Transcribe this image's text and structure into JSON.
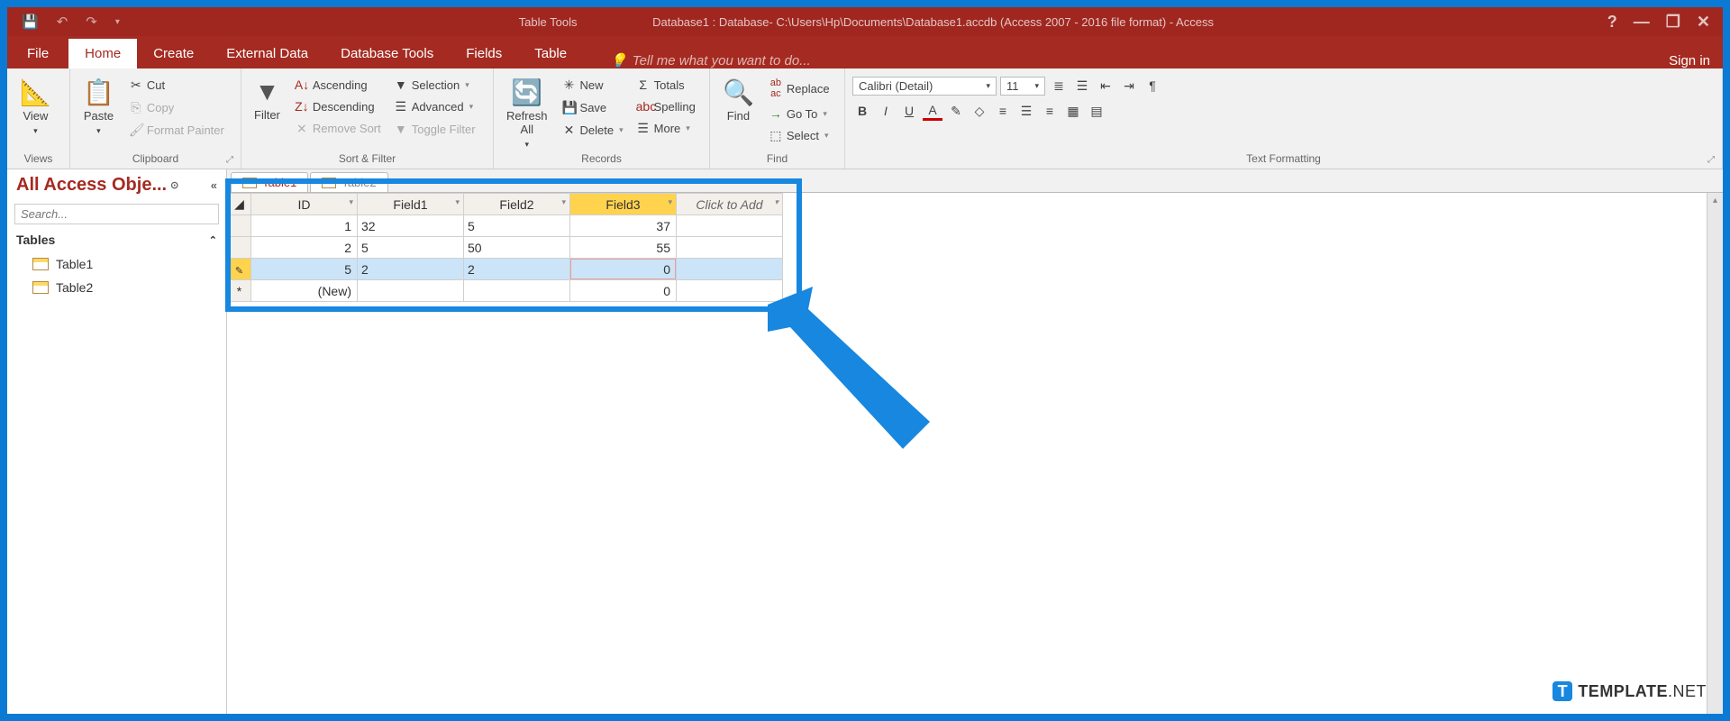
{
  "titlebar": {
    "table_tools": "Table Tools",
    "title": "Database1 : Database- C:\\Users\\Hp\\Documents\\Database1.accdb (Access 2007 - 2016 file format) - Access"
  },
  "menu": {
    "file": "File",
    "home": "Home",
    "create": "Create",
    "external_data": "External Data",
    "database_tools": "Database Tools",
    "fields": "Fields",
    "table": "Table",
    "tellme": "Tell me what you want to do...",
    "signin": "Sign in"
  },
  "ribbon": {
    "views": {
      "label": "Views",
      "view": "View"
    },
    "clipboard": {
      "label": "Clipboard",
      "paste": "Paste",
      "cut": "Cut",
      "copy": "Copy",
      "format_painter": "Format Painter"
    },
    "sort_filter": {
      "label": "Sort & Filter",
      "filter": "Filter",
      "ascending": "Ascending",
      "descending": "Descending",
      "remove_sort": "Remove Sort",
      "selection": "Selection",
      "advanced": "Advanced",
      "toggle_filter": "Toggle Filter"
    },
    "records": {
      "label": "Records",
      "refresh_all": "Refresh\nAll",
      "new": "New",
      "save": "Save",
      "delete": "Delete",
      "totals": "Totals",
      "spelling": "Spelling",
      "more": "More"
    },
    "find": {
      "label": "Find",
      "find": "Find",
      "replace": "Replace",
      "goto": "Go To",
      "select": "Select"
    },
    "text_formatting": {
      "label": "Text Formatting",
      "font_name": "Calibri (Detail)",
      "font_size": "11"
    }
  },
  "nav": {
    "header": "All Access Obje...",
    "search_placeholder": "Search...",
    "group": "Tables",
    "items": [
      "Table1",
      "Table2"
    ]
  },
  "doc_tabs": [
    "Table1",
    "Table2"
  ],
  "datasheet": {
    "headers": {
      "id": "ID",
      "f1": "Field1",
      "f2": "Field2",
      "f3": "Field3",
      "add": "Click to Add"
    },
    "rows": [
      {
        "id": "1",
        "f1": "32",
        "f2": "5",
        "f3": "37"
      },
      {
        "id": "2",
        "f1": "5",
        "f2": "50",
        "f3": "55"
      },
      {
        "id": "5",
        "f1": "2",
        "f2": "2",
        "f3": "0",
        "editing": true
      },
      {
        "id": "(New)",
        "f1": "",
        "f2": "",
        "f3": "0",
        "new": true
      }
    ]
  },
  "watermark": {
    "brand": "TEMPLATE",
    "suffix": ".NET"
  }
}
